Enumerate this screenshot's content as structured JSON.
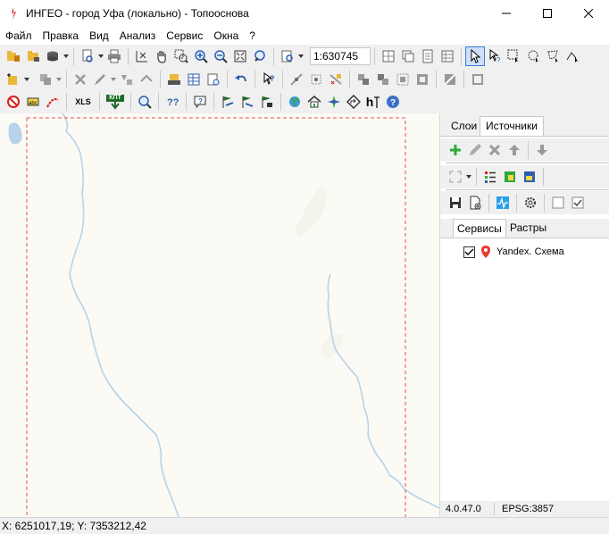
{
  "window": {
    "title": "ИНГЕО - город Уфа (локально) - Топооснова",
    "controls": [
      "minimize",
      "maximize",
      "close"
    ]
  },
  "menu": [
    "Файл",
    "Правка",
    "Вид",
    "Анализ",
    "Сервис",
    "Окна",
    "?"
  ],
  "toolbar": {
    "scale_value": "1:630745",
    "xls_label": "XLS",
    "kpt_label": "КПТ",
    "height_label": "h"
  },
  "panel": {
    "tabs": [
      "Слои",
      "Источники"
    ],
    "active_tab": "Источники",
    "subtabs": [
      "Сервисы",
      "Растры"
    ],
    "active_subtab": "Сервисы",
    "sources": [
      {
        "label": "Yandex. Схема",
        "checked": true
      }
    ],
    "version": "4.0.47.0",
    "projection": "EPSG:3857"
  },
  "status": {
    "coords": "X: 6251017,19; Y: 7353212,42"
  },
  "colors": {
    "map_background": "#fbfaf4",
    "river": "#b5d3ea",
    "frame_dash": "#e05050",
    "selection": "#3d7bd9"
  }
}
